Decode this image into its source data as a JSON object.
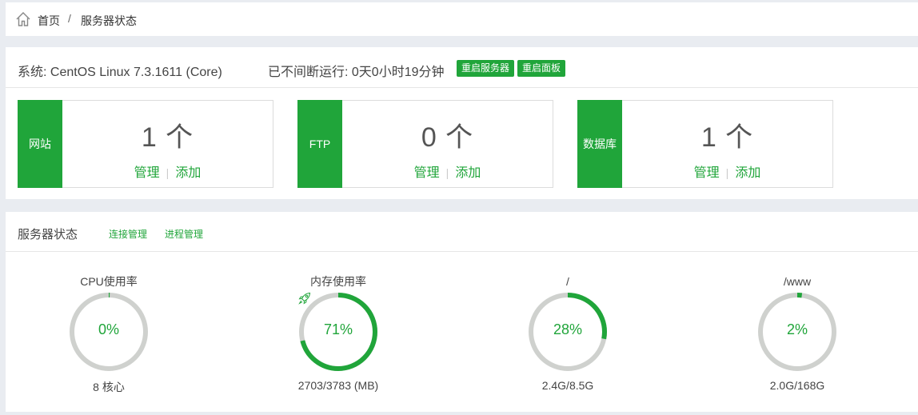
{
  "breadcrumb": {
    "home": "首页",
    "separator": "/",
    "current": "服务器状态"
  },
  "system": {
    "os_label": "系统: CentOS Linux 7.3.1611 (Core)",
    "uptime_label": "已不间断运行: 0天0小时19分钟",
    "restart_server": "重启服务器",
    "restart_panel": "重启面板"
  },
  "cards": [
    {
      "name": "网站",
      "count": "1 个",
      "manage": "管理",
      "add": "添加"
    },
    {
      "name": "FTP",
      "count": "0 个",
      "manage": "管理",
      "add": "添加"
    },
    {
      "name": "数据库",
      "count": "1 个",
      "manage": "管理",
      "add": "添加"
    }
  ],
  "status": {
    "title": "服务器状态",
    "conn_manage": "连接管理",
    "proc_manage": "进程管理",
    "gauges": [
      {
        "label": "CPU使用率",
        "percent": 0,
        "percent_text": "0%",
        "sub": "8 核心"
      },
      {
        "label": "内存使用率",
        "percent": 71,
        "percent_text": "71%",
        "sub": "2703/3783 (MB)",
        "icon": "rocket-icon"
      },
      {
        "label": "/",
        "percent": 28,
        "percent_text": "28%",
        "sub": "2.4G/8.5G"
      },
      {
        "label": "/www",
        "percent": 2,
        "percent_text": "2%",
        "sub": "2.0G/168G"
      }
    ]
  },
  "colors": {
    "accent": "#20a53a",
    "ring_bg": "#cfd1ce"
  }
}
